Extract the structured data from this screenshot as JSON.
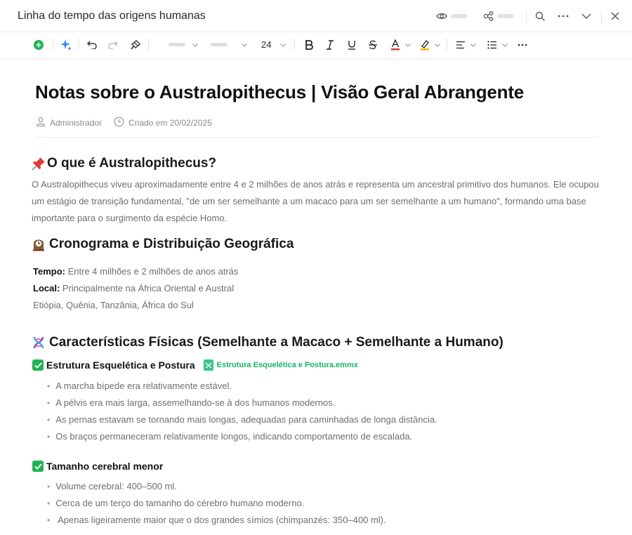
{
  "window": {
    "title": "Linha do tempo das origens humanas"
  },
  "toolbar": {
    "font_size": "24"
  },
  "document": {
    "title": "Notas sobre o Australopithecus | Visão Geral Abrangente",
    "author": "Administrador",
    "created": "Criado em 20/02/2025",
    "section1": {
      "heading": "O que é Australopithecus?",
      "paragraph": "O Australopithecus viveu aproximadamente entre 4 e 2 milhões de anos atrás e representa um ancestral primitivo dos humanos. Ele ocupou um estágio de transição fundamental, \"de um ser semelhante a um macaco para um ser semelhante a um humano\", formando uma base importante para o surgimento da espécie Homo."
    },
    "section2": {
      "heading": "Cronograma e Distribuição Geográfica",
      "time_label": "Tempo:",
      "time_value": " Entre 4 milhões e 2 milhões de anos atrás",
      "place_label": "Local:",
      "place_value": " Principalmente na África Oriental e Austral",
      "countries": "Etiópia, Quênia, Tanzânia, África do Sul"
    },
    "section3": {
      "heading": "Características Físicas (Semelhante a Macaco + Semelhante a Humano)",
      "sub1": {
        "heading": "Estrutura Esquelética e Postura",
        "attachment": "Estrutura Esquelética e Postura.emmx",
        "items": [
          "A marcha bípede era relativamente estável.",
          "A pélvis era mais larga, assemelhando-se à dos humanos modernos.",
          "As pernas estavam se tornando mais longas, adequadas para caminhadas de longa distância.",
          "Os braços permaneceram relativamente longos, indicando comportamento de escalada."
        ]
      },
      "sub2": {
        "heading": "Tamanho cerebral menor",
        "items": [
          "Volume cerebral: 400–500 ml.",
          "Cerca de um terço do tamanho do cérebro humano moderno.",
          " Apenas ligeiramente maior que o dos grandes símios (chimpanzés: 350–400 ml)."
        ]
      }
    }
  },
  "colors": {
    "accent_green": "#1fb354",
    "attachment_green": "#19b36b",
    "text_muted": "#6e6e6e"
  },
  "icons": [
    "eye-icon",
    "share-icon",
    "search-icon",
    "more-icon",
    "chevron-down-icon",
    "close-icon",
    "add-icon",
    "ai-sparkle-icon",
    "undo-icon",
    "redo-icon",
    "format-painter-icon",
    "bold-icon",
    "italic-icon",
    "underline-icon",
    "strikethrough-icon",
    "font-color-icon",
    "highlight-icon",
    "align-icon",
    "list-icon",
    "user-icon",
    "clock-icon",
    "pushpin-icon",
    "mantel-clock-icon",
    "dna-icon",
    "checkmark-icon",
    "mindmap-file-icon"
  ]
}
